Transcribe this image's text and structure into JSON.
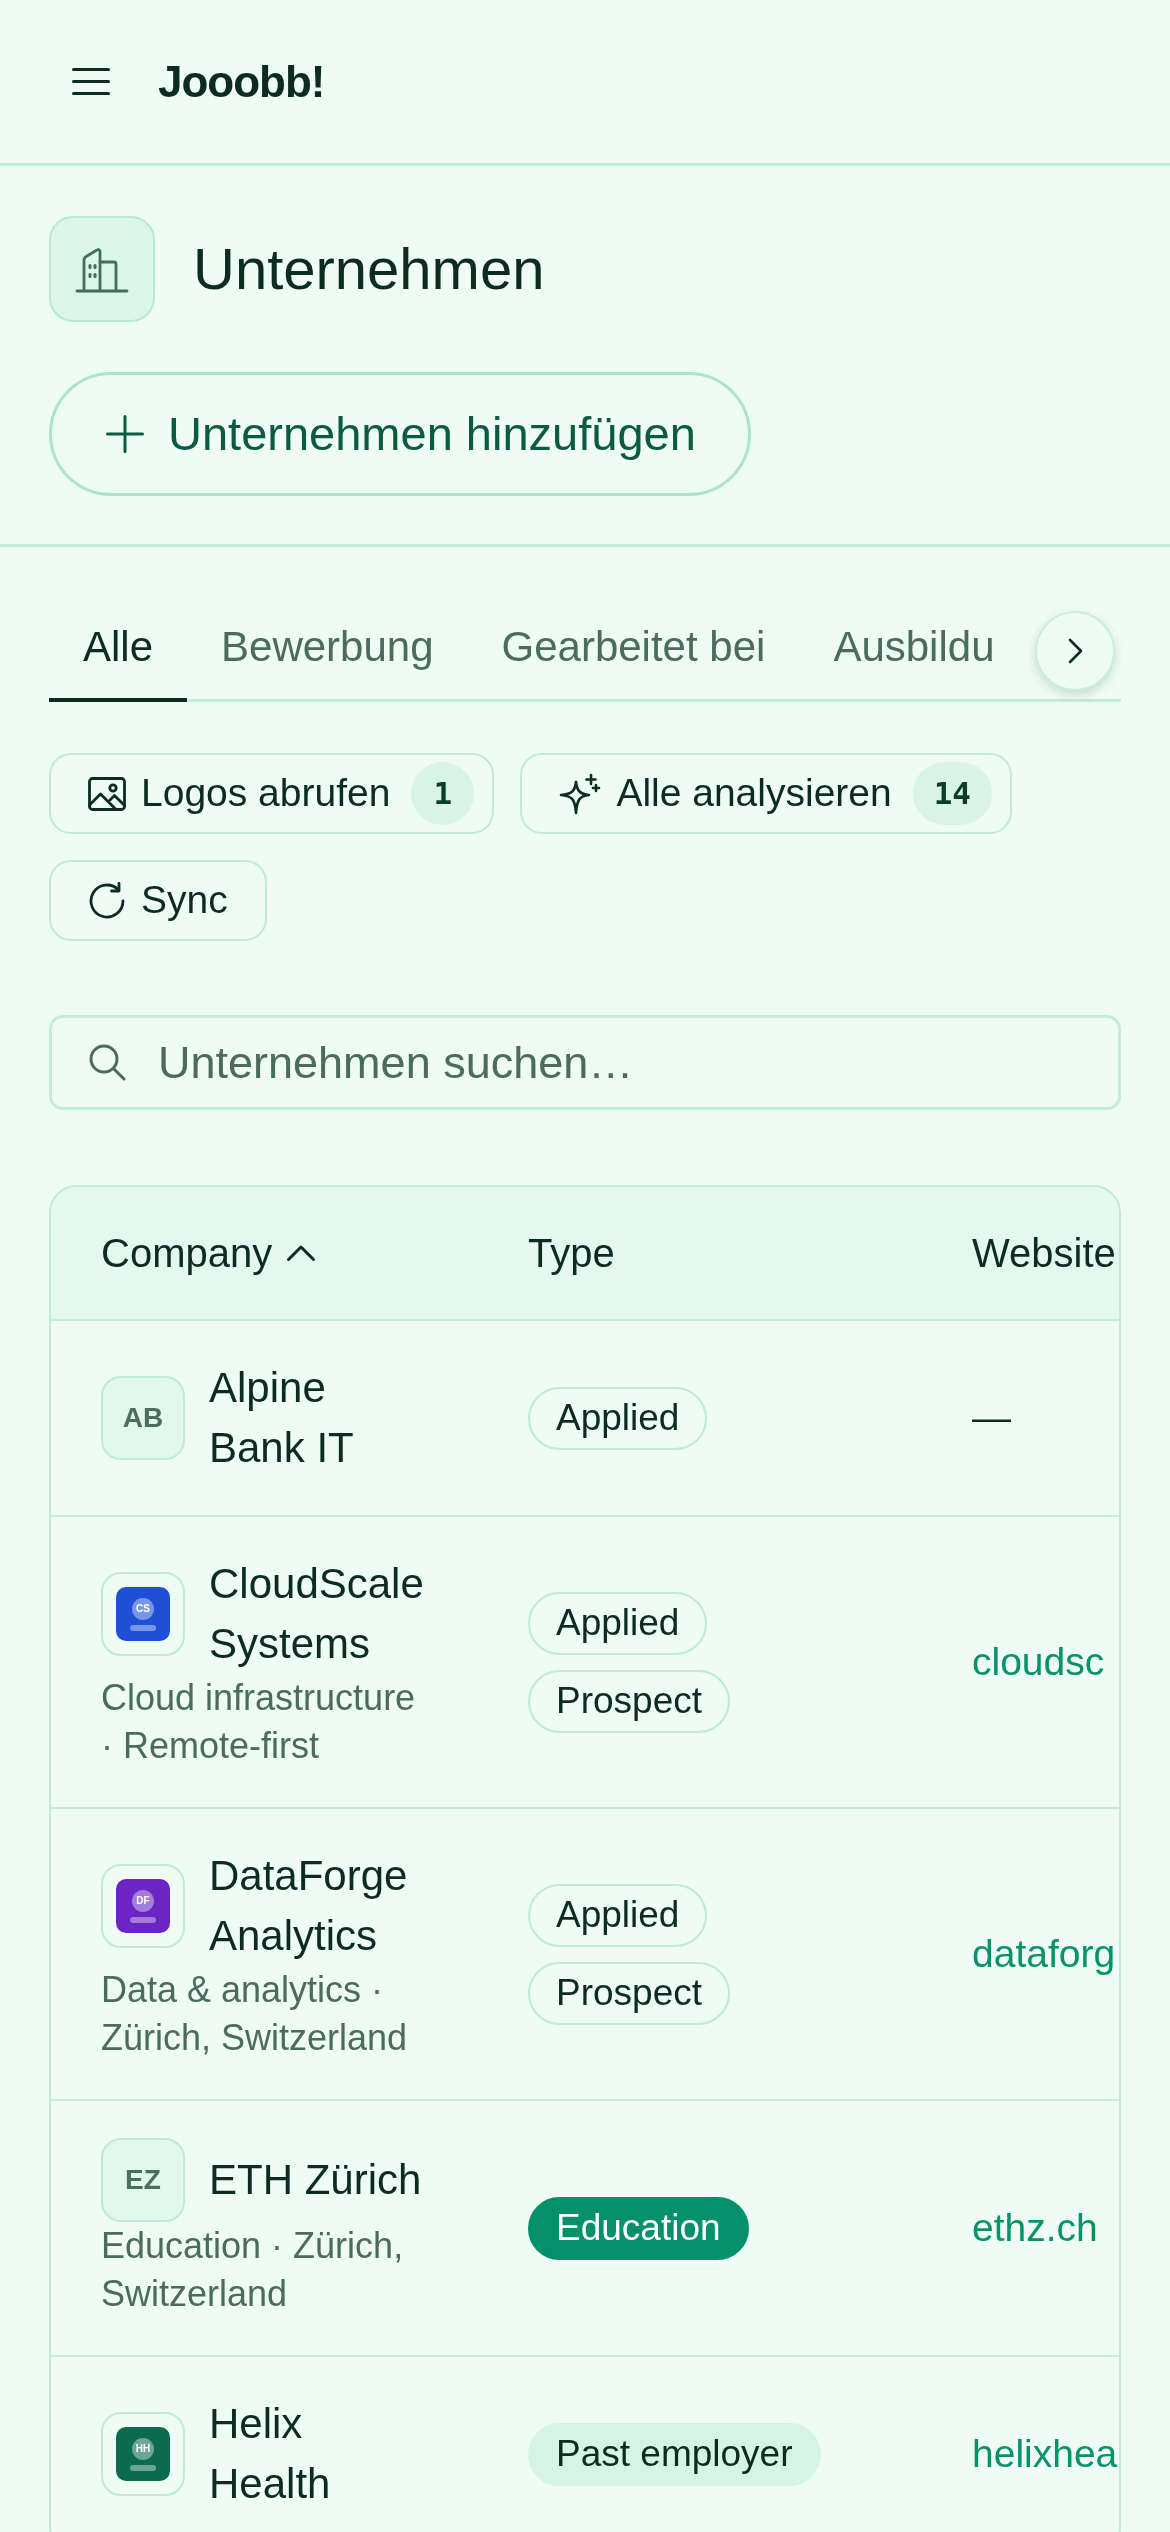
{
  "header": {
    "brand": "Jooobb!"
  },
  "page": {
    "title": "Unternehmen",
    "add_button": "Unternehmen hinzufügen"
  },
  "tabs": [
    {
      "label": "Alle",
      "selected": true
    },
    {
      "label": "Bewerbung",
      "selected": false
    },
    {
      "label": "Gearbeitet bei",
      "selected": false
    },
    {
      "label": "Ausbildu",
      "selected": false
    }
  ],
  "actions": [
    {
      "kind": "logos",
      "label": "Logos abrufen",
      "count": "1"
    },
    {
      "kind": "analyze",
      "label": "Alle analysieren",
      "count": "14"
    },
    {
      "kind": "sync",
      "label": "Sync"
    }
  ],
  "search": {
    "placeholder": "Unternehmen suchen…"
  },
  "table": {
    "columns": [
      {
        "label": "Company",
        "sorted": true
      },
      {
        "label": "Type",
        "sorted": false
      },
      {
        "label": "Website",
        "sorted": false
      }
    ],
    "rows": [
      {
        "logo": {
          "kind": "initials",
          "text": "AB"
        },
        "name": "Alpine Bank IT",
        "types": [
          {
            "label": "Applied",
            "kind": "outline"
          }
        ],
        "website": {
          "text": "—",
          "kind": "none"
        }
      },
      {
        "logo": {
          "kind": "image",
          "text": "CS",
          "color": "#1f4fd6"
        },
        "name": "CloudScale Systems",
        "description": "Cloud infrastructure · Remote-first",
        "types": [
          {
            "label": "Applied",
            "kind": "outline"
          },
          {
            "label": "Prospect",
            "kind": "outline"
          }
        ],
        "website": {
          "text": "cloudsc",
          "kind": "link"
        }
      },
      {
        "logo": {
          "kind": "image",
          "text": "DF",
          "color": "#6a25c4"
        },
        "name": "DataForge Analytics",
        "description": "Data & analytics · Zürich, Switzerland",
        "types": [
          {
            "label": "Applied",
            "kind": "outline"
          },
          {
            "label": "Prospect",
            "kind": "outline"
          }
        ],
        "website": {
          "text": "dataforg",
          "kind": "link"
        }
      },
      {
        "logo": {
          "kind": "initials",
          "text": "EZ"
        },
        "name": "ETH Zürich",
        "description": "Education · Zürich, Switzerland",
        "types": [
          {
            "label": "Education",
            "kind": "filled"
          }
        ],
        "website": {
          "text": "ethz.ch",
          "kind": "link"
        }
      },
      {
        "logo": {
          "kind": "image",
          "text": "HH",
          "color": "#0c6a4d"
        },
        "name": "Helix Health",
        "types": [
          {
            "label": "Past employer",
            "kind": "soft"
          }
        ],
        "website": {
          "text": "helixhea",
          "kind": "link"
        }
      }
    ]
  }
}
